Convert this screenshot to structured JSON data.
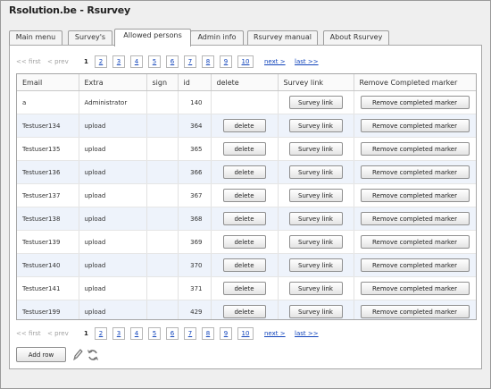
{
  "window": {
    "title": "Rsolution.be - Rsurvey"
  },
  "tabs": [
    {
      "label": "Main menu"
    },
    {
      "label": "Survey's"
    },
    {
      "label": "Allowed persons"
    },
    {
      "label": "Admin info"
    },
    {
      "label": "Rsurvey manual"
    },
    {
      "label": "About Rsurvey"
    }
  ],
  "active_tab": "Allowed persons",
  "pager": {
    "first": "<< first",
    "prev": "< prev",
    "current": "1",
    "pages": [
      "2",
      "3",
      "4",
      "5",
      "6",
      "7",
      "8",
      "9",
      "10"
    ],
    "next": "next >",
    "last": "last >>"
  },
  "table": {
    "columns": [
      "Email",
      "Extra",
      "sign",
      "id",
      "delete",
      "Survey link",
      "Remove Completed marker"
    ],
    "rows": [
      {
        "email": "a",
        "extra": "Administrator",
        "sign": "",
        "id": "140",
        "delete": "",
        "survey_link": "Survey link",
        "remove": "Remove completed marker"
      },
      {
        "email": "Testuser134",
        "extra": "upload",
        "sign": "",
        "id": "364",
        "delete": "delete",
        "survey_link": "Survey link",
        "remove": "Remove completed marker"
      },
      {
        "email": "Testuser135",
        "extra": "upload",
        "sign": "",
        "id": "365",
        "delete": "delete",
        "survey_link": "Survey link",
        "remove": "Remove completed marker"
      },
      {
        "email": "Testuser136",
        "extra": "upload",
        "sign": "",
        "id": "366",
        "delete": "delete",
        "survey_link": "Survey link",
        "remove": "Remove completed marker"
      },
      {
        "email": "Testuser137",
        "extra": "upload",
        "sign": "",
        "id": "367",
        "delete": "delete",
        "survey_link": "Survey link",
        "remove": "Remove completed marker"
      },
      {
        "email": "Testuser138",
        "extra": "upload",
        "sign": "",
        "id": "368",
        "delete": "delete",
        "survey_link": "Survey link",
        "remove": "Remove completed marker"
      },
      {
        "email": "Testuser139",
        "extra": "upload",
        "sign": "",
        "id": "369",
        "delete": "delete",
        "survey_link": "Survey link",
        "remove": "Remove completed marker"
      },
      {
        "email": "Testuser140",
        "extra": "upload",
        "sign": "",
        "id": "370",
        "delete": "delete",
        "survey_link": "Survey link",
        "remove": "Remove completed marker"
      },
      {
        "email": "Testuser141",
        "extra": "upload",
        "sign": "",
        "id": "371",
        "delete": "delete",
        "survey_link": "Survey link",
        "remove": "Remove completed marker"
      },
      {
        "email": "Testuser199",
        "extra": "upload",
        "sign": "",
        "id": "429",
        "delete": "delete",
        "survey_link": "Survey link",
        "remove": "Remove completed marker"
      }
    ]
  },
  "footer": {
    "add_row": "Add row",
    "edit_icon": "pencil-icon",
    "refresh_icon": "refresh-icon"
  },
  "colors": {
    "link": "#1144bb",
    "row_alt": "#eef3fb",
    "border": "#a6a6a6"
  }
}
